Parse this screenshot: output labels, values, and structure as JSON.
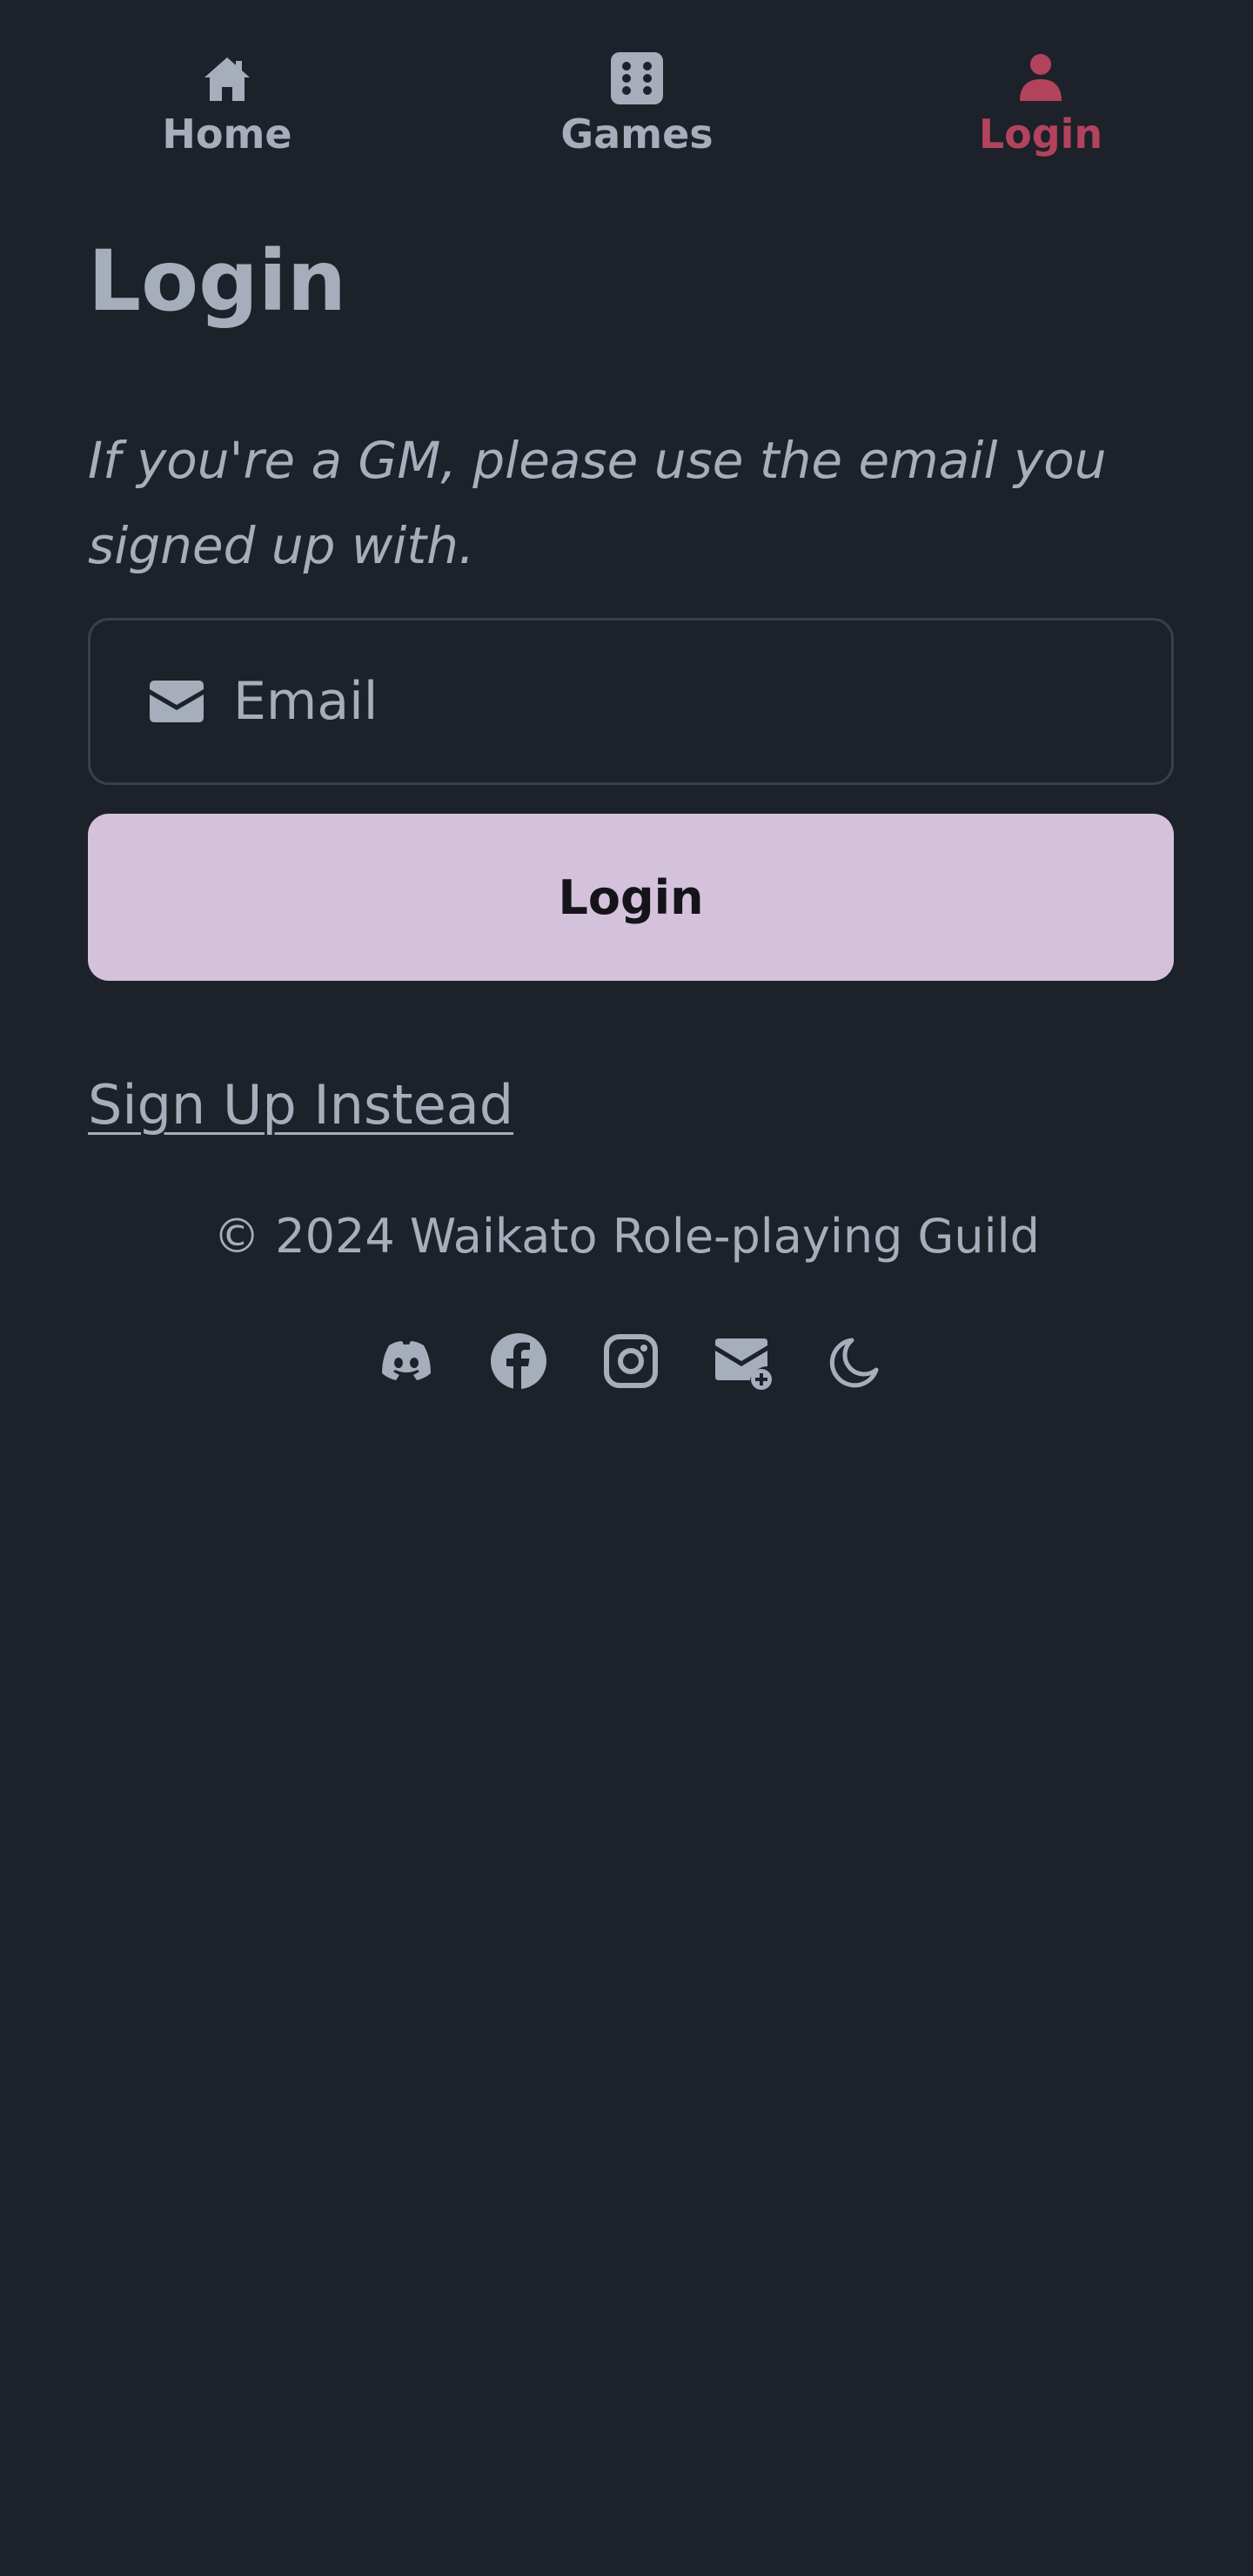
{
  "nav": {
    "items": [
      {
        "label": "Home",
        "icon": "home-icon"
      },
      {
        "label": "Games",
        "icon": "dice-icon"
      },
      {
        "label": "Login",
        "icon": "user-icon",
        "active": true
      }
    ],
    "active_color": "#b3435d"
  },
  "main": {
    "title": "Login",
    "note": "If you're a GM, please use the email you signed up with.",
    "email": {
      "placeholder": "Email",
      "value": "",
      "icon": "envelope-icon"
    },
    "login_button": "Login",
    "signup_link": "Sign Up Instead"
  },
  "footer": {
    "copyright": "© 2024 Waikato Role-playing Guild",
    "icons": [
      "discord-icon",
      "facebook-icon",
      "instagram-icon",
      "newsletter-icon",
      "moon-icon"
    ]
  },
  "colors": {
    "background": "#1d2129",
    "text": "#a6adbb",
    "button_bg": "#d4c2dc",
    "button_text": "#15141a",
    "input_border": "#3b4048"
  }
}
